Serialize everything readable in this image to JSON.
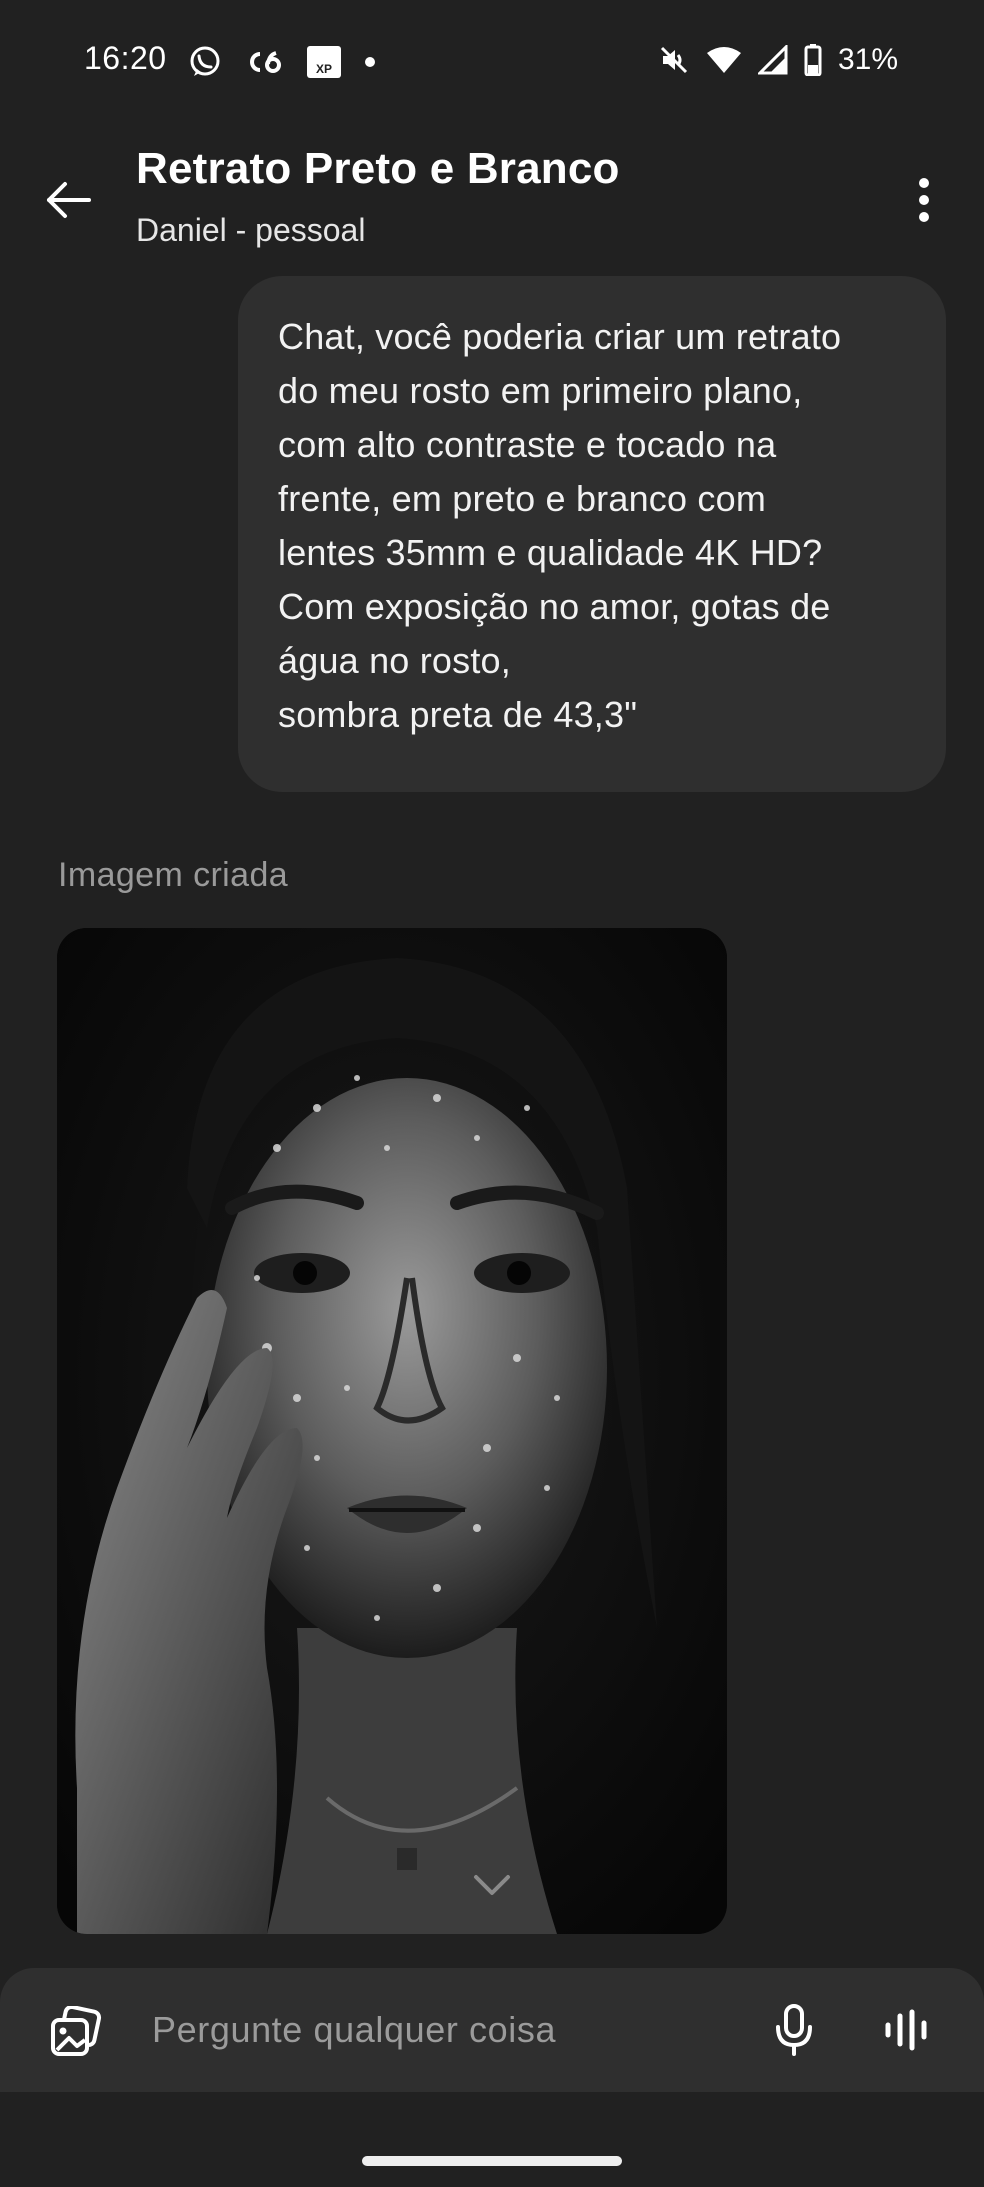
{
  "status_bar": {
    "time": "16:20",
    "battery": "31%",
    "left_icons": [
      "whatsapp-icon",
      "c6-bank-icon",
      "xp-icon",
      "notification-dot-icon"
    ],
    "right_icons": [
      "mute-icon",
      "wifi-icon",
      "signal-icon",
      "battery-icon"
    ]
  },
  "header": {
    "title": "Retrato Preto e Branco",
    "subtitle": "Daniel - pessoal",
    "back_icon": "arrow-left-icon",
    "menu_icon": "more-vertical-icon"
  },
  "messages": {
    "user_lines": [
      "Chat, você poderia criar um retrato",
      "do meu rosto em primeiro plano,",
      "com alto contraste e tocado na",
      "frente, em preto e branco com",
      "lentes 35mm e qualidade 4K HD?",
      "Com exposição no amor, gotas de",
      "água no rosto,",
      "sombra preta de 43,3\""
    ],
    "assistant_image_label": "Imagem criada"
  },
  "composer": {
    "placeholder": "Pergunte qualquer coisa",
    "attach_icon": "image-gallery-icon",
    "mic_icon": "microphone-icon",
    "voice_icon": "voice-waveform-icon"
  },
  "colors": {
    "background": "#212121",
    "bubble": "#2f2f2f",
    "muted_text": "#9a9a9a"
  }
}
